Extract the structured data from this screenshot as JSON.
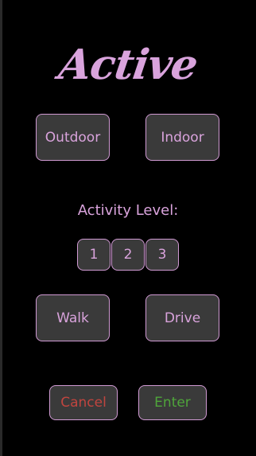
{
  "title": "Active",
  "location": {
    "outdoor_label": "Outdoor",
    "indoor_label": "Indoor"
  },
  "activity": {
    "label": "Activity Level:",
    "levels": [
      "1",
      "2",
      "3"
    ]
  },
  "transport": {
    "walk_label": "Walk",
    "drive_label": "Drive"
  },
  "actions": {
    "cancel_label": "Cancel",
    "enter_label": "Enter"
  },
  "colors": {
    "accent": "#d9a3dc",
    "background": "#000000",
    "button_fill": "#3a3a3a",
    "cancel_text": "#c0453f",
    "enter_text": "#4fa53a"
  }
}
